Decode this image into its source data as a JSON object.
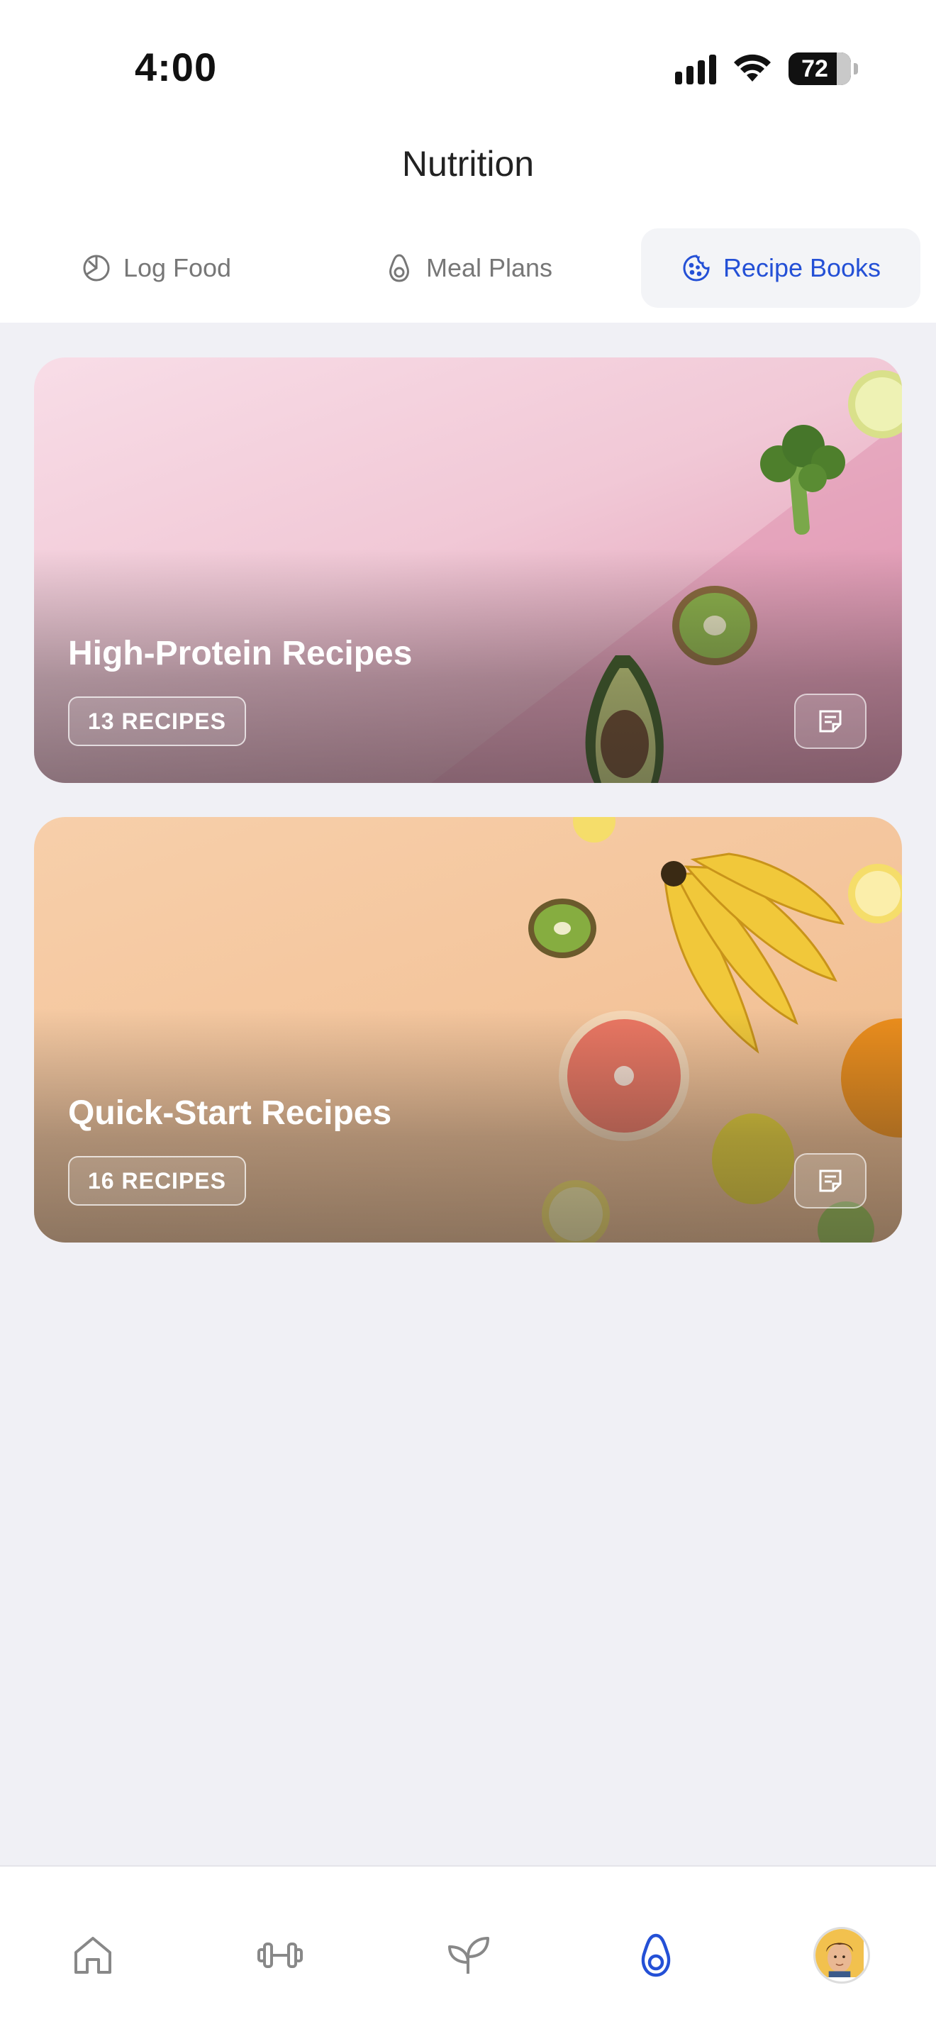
{
  "status_bar": {
    "time": "4:00",
    "battery": "72",
    "icons": [
      "signal-icon",
      "wifi-icon",
      "battery-icon"
    ]
  },
  "header": {
    "title": "Nutrition"
  },
  "tabs": [
    {
      "label": "Log Food",
      "icon": "pie-chart-icon",
      "selected": false
    },
    {
      "label": "Meal Plans",
      "icon": "avocado-icon",
      "selected": false
    },
    {
      "label": "Recipe Books",
      "icon": "cookie-icon",
      "selected": true
    }
  ],
  "recipe_books": [
    {
      "title": "High-Protein Recipes",
      "count_label": "13 RECIPES",
      "action_icon": "notes-icon"
    },
    {
      "title": "Quick-Start Recipes",
      "count_label": "16 RECIPES",
      "action_icon": "notes-icon"
    }
  ],
  "bottom_nav": [
    {
      "icon": "home-icon",
      "active": false
    },
    {
      "icon": "dumbbell-icon",
      "active": false
    },
    {
      "icon": "leaf-icon",
      "active": false
    },
    {
      "icon": "avocado-icon",
      "active": true
    },
    {
      "icon": "avatar",
      "active": false
    }
  ],
  "colors": {
    "accent": "#2450d6",
    "background": "#f0f0f5",
    "tab_inactive": "#777777"
  }
}
